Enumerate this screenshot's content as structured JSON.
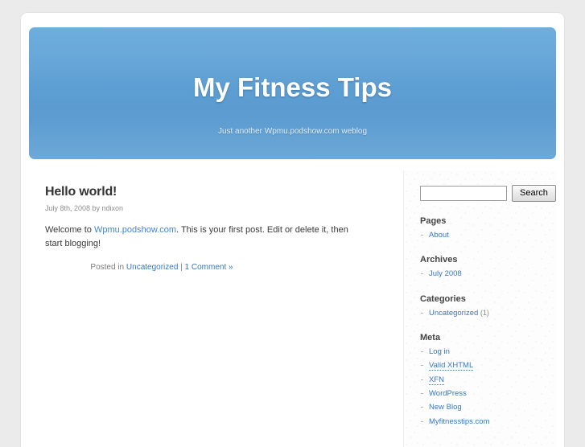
{
  "header": {
    "title": "My Fitness Tips",
    "tagline": "Just another Wpmu.podshow.com weblog"
  },
  "post": {
    "title": "Hello world!",
    "date_line": "July 8th, 2008 by ndixon",
    "body_before_link": "Welcome to ",
    "body_link": "Wpmu.podshow.com",
    "body_after_link": ". This is your first post. Edit or delete it, then start blogging!",
    "meta_posted_in": "Posted in ",
    "meta_category": "Uncategorized",
    "meta_separator": " | ",
    "meta_comments": "1 Comment »"
  },
  "sidebar": {
    "search": {
      "value": "",
      "placeholder": "",
      "button_label": "Search"
    },
    "sections": [
      {
        "heading": "Pages",
        "items": [
          {
            "label": "About",
            "count": ""
          }
        ]
      },
      {
        "heading": "Archives",
        "items": [
          {
            "label": "July 2008",
            "count": ""
          }
        ]
      },
      {
        "heading": "Categories",
        "items": [
          {
            "label": "Uncategorized",
            "count": "(1)"
          }
        ]
      },
      {
        "heading": "Meta",
        "items": [
          {
            "label": "Log in",
            "count": ""
          },
          {
            "label": "Valid XHTML",
            "count": ""
          },
          {
            "label": "XFN",
            "count": ""
          },
          {
            "label": "WordPress",
            "count": ""
          },
          {
            "label": "New Blog",
            "count": ""
          },
          {
            "label": "Myfitnesstips.com",
            "count": ""
          }
        ]
      }
    ]
  },
  "colors": {
    "page_background": "#ebebeb",
    "container": "#ffffff",
    "header_blue_top": "#6daede",
    "header_blue_bottom": "#62a2d5",
    "link": "#3778c2",
    "heading_text": "#444444",
    "muted_text": "#8f8f8f"
  }
}
